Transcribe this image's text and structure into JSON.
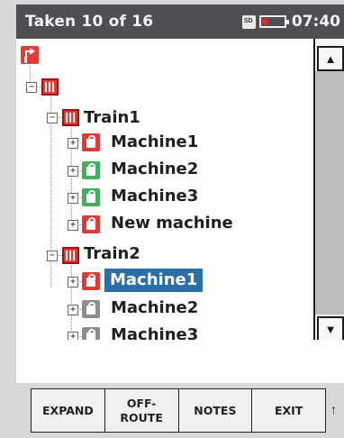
{
  "status": {
    "title": "Taken 10 of 16",
    "card_label": "SD",
    "time": "07:40"
  },
  "tree": {
    "root": {
      "icon": "red-return-icon"
    },
    "trains": [
      {
        "label": "Train1",
        "machines": [
          {
            "label": "Machine1",
            "color": "#e13a35"
          },
          {
            "label": "Machine2",
            "color": "#3fb15a"
          },
          {
            "label": "Machine3",
            "color": "#3fb15a"
          },
          {
            "label": "New machine",
            "color": "#e13a35"
          }
        ]
      },
      {
        "label": "Train2",
        "machines": [
          {
            "label": "Machine1",
            "color": "#e13a35",
            "selected": true
          },
          {
            "label": "Machine2",
            "color": "#8d8d8d"
          },
          {
            "label": "Machine3",
            "color": "#8d8d8d"
          }
        ]
      }
    ]
  },
  "softkeys": [
    "EXPAND",
    "OFF-\nROUTE",
    "NOTES",
    "EXIT"
  ],
  "scroll_symbols": {
    "up": "▲",
    "down": "▼"
  },
  "arrow": "↑"
}
